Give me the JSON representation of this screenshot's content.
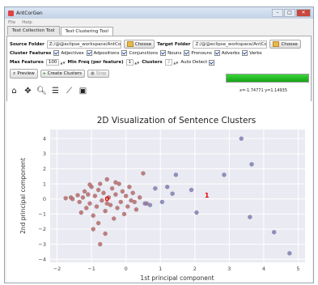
{
  "window": {
    "title": "AntCorGen"
  },
  "menu": [
    "File",
    "Help"
  ],
  "tabs": [
    "Text Collection Tool",
    "Text Clustering Tool"
  ],
  "source": {
    "label": "Source Folder",
    "value": "Z:/@@eclipse_workspace/AntCor",
    "choose": "Choose"
  },
  "target": {
    "label": "Target Folder",
    "value": "Z:/@@eclipse_workspace/AntCor",
    "choose": "Choose"
  },
  "cluster_features": {
    "label": "Cluster Features",
    "options": [
      "Adjectives",
      "Adpositions",
      "Conjunctions",
      "Nouns",
      "Pronouns",
      "Adverbs",
      "Verbs"
    ]
  },
  "params": {
    "max_features_label": "Max Features",
    "max_features": "100",
    "min_freq_label": "Min Freq (per feature)",
    "min_freq": "1",
    "clusters_label": "Clusters",
    "clusters": "2",
    "auto_detect": "Auto Detect"
  },
  "buttons": {
    "preview": "Preview",
    "create": "Create Clusters",
    "stop": "Stop"
  },
  "progress": 1.0,
  "toolbar_icons": [
    "home-icon",
    "pan-icon",
    "zoom-icon",
    "configure-icon",
    "lines-icon",
    "save-icon"
  ],
  "coords": "x=-1.74771    y=1.14935",
  "chart_data": {
    "type": "scatter",
    "title": "2D Visualization of Sentence Clusters",
    "xlabel": "1st principal component",
    "ylabel": "2nd principal component",
    "xlim": [
      -2.2,
      5.2
    ],
    "ylim": [
      -4.2,
      4.6
    ],
    "xticks": [
      "-2",
      "-1",
      "0",
      "1",
      "2",
      "3",
      "4",
      "5"
    ],
    "yticks": [
      "-4",
      "-3",
      "-2",
      "-1",
      "0",
      "1",
      "2",
      "3",
      "4"
    ],
    "colors": {
      "cluster_0": "#b56b6b",
      "cluster_1": "#7d7fb5",
      "centroid": "#e60000"
    },
    "centroid_labels": [
      {
        "text": "0",
        "x": -0.55,
        "y": 0.0
      },
      {
        "text": "1",
        "x": 2.35,
        "y": 0.25
      }
    ],
    "series": [
      {
        "points": [
          [
            -1.75,
            0.05
          ],
          [
            -1.6,
            0.1
          ],
          [
            -1.55,
            0.0
          ],
          [
            -1.4,
            0.25
          ],
          [
            -1.35,
            -0.2
          ],
          [
            -1.25,
            0.1
          ],
          [
            -1.2,
            0.5
          ],
          [
            -1.15,
            -0.6
          ],
          [
            -1.1,
            0.3
          ],
          [
            -1.05,
            -0.3
          ],
          [
            -1.0,
            0.8
          ],
          [
            -0.95,
            -1.1
          ],
          [
            -0.9,
            0.2
          ],
          [
            -0.85,
            -0.5
          ],
          [
            -0.8,
            0.6
          ],
          [
            -0.8,
            -1.6
          ],
          [
            -0.75,
            1.0
          ],
          [
            -0.7,
            -0.1
          ],
          [
            -0.65,
            0.4
          ],
          [
            -0.6,
            -0.8
          ],
          [
            -0.55,
            1.3
          ],
          [
            -0.5,
            0.1
          ],
          [
            -0.45,
            -0.4
          ],
          [
            -0.4,
            0.7
          ],
          [
            -0.35,
            -1.3
          ],
          [
            -0.3,
            0.3
          ],
          [
            -0.25,
            -0.6
          ],
          [
            -0.2,
            1.0
          ],
          [
            -0.15,
            -0.2
          ],
          [
            -0.1,
            0.5
          ],
          [
            -0.05,
            -1.0
          ],
          [
            0.0,
            0.2
          ],
          [
            0.05,
            -0.5
          ],
          [
            0.1,
            0.8
          ],
          [
            0.15,
            -0.1
          ],
          [
            0.2,
            0.4
          ],
          [
            0.3,
            -0.7
          ],
          [
            0.4,
            0.1
          ],
          [
            0.5,
            1.7
          ],
          [
            0.6,
            -0.3
          ],
          [
            -1.3,
            -0.9
          ],
          [
            -0.95,
            -2.0
          ],
          [
            -0.6,
            -2.3
          ],
          [
            -0.75,
            -3.0
          ],
          [
            -1.05,
            0.95
          ],
          [
            -0.3,
            1.1
          ],
          [
            0.25,
            -0.2
          ],
          [
            -0.55,
            -0.3
          ]
        ]
      },
      {
        "points": [
          [
            3.35,
            4.0
          ],
          [
            3.65,
            2.3
          ],
          [
            2.85,
            1.6
          ],
          [
            1.45,
            1.6
          ],
          [
            1.2,
            0.8
          ],
          [
            0.85,
            0.7
          ],
          [
            1.05,
            -0.2
          ],
          [
            0.7,
            -0.4
          ],
          [
            1.35,
            0.35
          ],
          [
            1.9,
            0.6
          ],
          [
            2.05,
            -0.9
          ],
          [
            3.6,
            -1.2
          ],
          [
            4.3,
            -2.2
          ],
          [
            4.75,
            -3.6
          ],
          [
            0.55,
            -0.3
          ]
        ]
      }
    ]
  }
}
